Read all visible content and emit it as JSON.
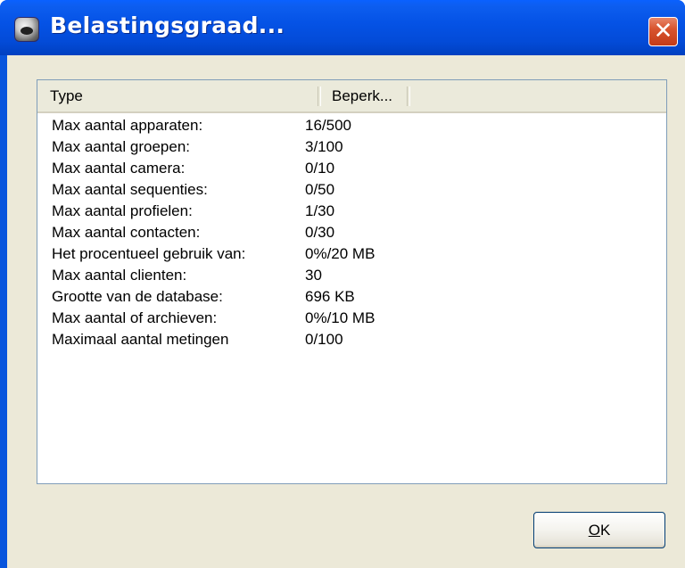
{
  "window": {
    "title": "Belastingsgraad...",
    "close_glyph": "✕"
  },
  "list": {
    "columns": [
      "Type",
      "Beperk..."
    ],
    "rows": [
      {
        "type": "Max aantal apparaten:",
        "limit": "16/500"
      },
      {
        "type": "Max aantal groepen:",
        "limit": "3/100"
      },
      {
        "type": "Max aantal camera:",
        "limit": "0/10"
      },
      {
        "type": "Max aantal sequenties:",
        "limit": "0/50"
      },
      {
        "type": "Max aantal profielen:",
        "limit": "1/30"
      },
      {
        "type": "Max aantal contacten:",
        "limit": "0/30"
      },
      {
        "type": "Het procentueel gebruik van:",
        "limit": "0%/20 MB"
      },
      {
        "type": "Max aantal clienten:",
        "limit": "30"
      },
      {
        "type": "Grootte van de database:",
        "limit": "696 KB"
      },
      {
        "type": "Max aantal of archieven:",
        "limit": "0%/10 MB"
      },
      {
        "type": "Maximaal aantal metingen",
        "limit": "0/100"
      }
    ]
  },
  "buttons": {
    "ok_mnemonic": "O",
    "ok_rest": "K"
  },
  "icons": {
    "app": "app-camera-icon",
    "close": "close-icon"
  },
  "colors": {
    "titlebar": "#0553e6",
    "dialog_bg": "#ece9d8",
    "close_button": "#d8542f"
  }
}
